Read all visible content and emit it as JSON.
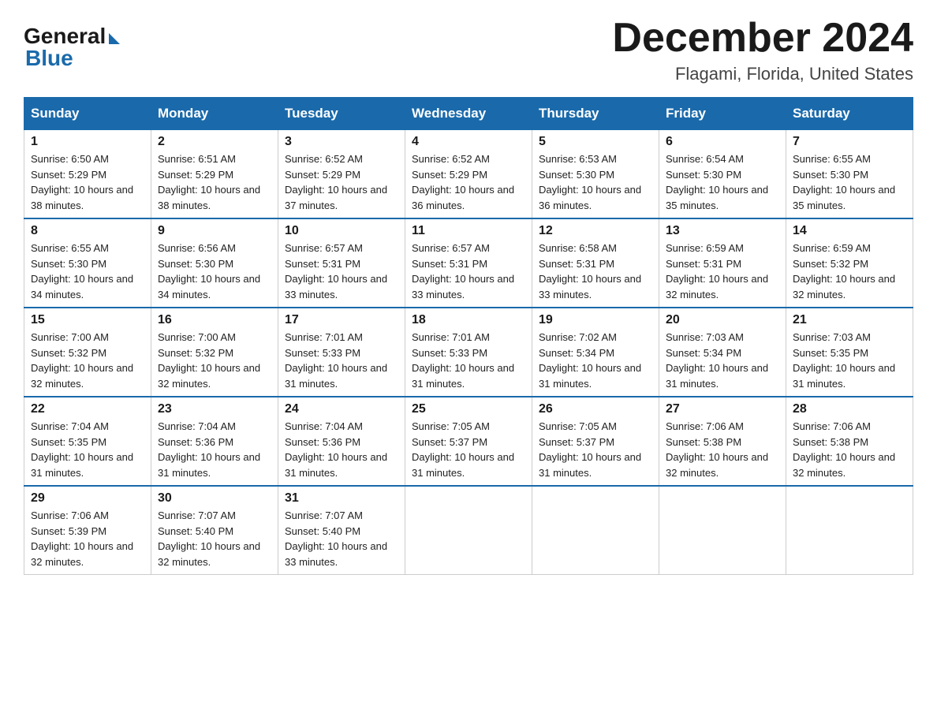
{
  "logo": {
    "general_text": "General",
    "blue_text": "Blue"
  },
  "header": {
    "month_year": "December 2024",
    "location": "Flagami, Florida, United States"
  },
  "days_of_week": [
    "Sunday",
    "Monday",
    "Tuesday",
    "Wednesday",
    "Thursday",
    "Friday",
    "Saturday"
  ],
  "weeks": [
    {
      "days": [
        {
          "num": "1",
          "sunrise": "6:50 AM",
          "sunset": "5:29 PM",
          "daylight": "10 hours and 38 minutes."
        },
        {
          "num": "2",
          "sunrise": "6:51 AM",
          "sunset": "5:29 PM",
          "daylight": "10 hours and 38 minutes."
        },
        {
          "num": "3",
          "sunrise": "6:52 AM",
          "sunset": "5:29 PM",
          "daylight": "10 hours and 37 minutes."
        },
        {
          "num": "4",
          "sunrise": "6:52 AM",
          "sunset": "5:29 PM",
          "daylight": "10 hours and 36 minutes."
        },
        {
          "num": "5",
          "sunrise": "6:53 AM",
          "sunset": "5:30 PM",
          "daylight": "10 hours and 36 minutes."
        },
        {
          "num": "6",
          "sunrise": "6:54 AM",
          "sunset": "5:30 PM",
          "daylight": "10 hours and 35 minutes."
        },
        {
          "num": "7",
          "sunrise": "6:55 AM",
          "sunset": "5:30 PM",
          "daylight": "10 hours and 35 minutes."
        }
      ]
    },
    {
      "days": [
        {
          "num": "8",
          "sunrise": "6:55 AM",
          "sunset": "5:30 PM",
          "daylight": "10 hours and 34 minutes."
        },
        {
          "num": "9",
          "sunrise": "6:56 AM",
          "sunset": "5:30 PM",
          "daylight": "10 hours and 34 minutes."
        },
        {
          "num": "10",
          "sunrise": "6:57 AM",
          "sunset": "5:31 PM",
          "daylight": "10 hours and 33 minutes."
        },
        {
          "num": "11",
          "sunrise": "6:57 AM",
          "sunset": "5:31 PM",
          "daylight": "10 hours and 33 minutes."
        },
        {
          "num": "12",
          "sunrise": "6:58 AM",
          "sunset": "5:31 PM",
          "daylight": "10 hours and 33 minutes."
        },
        {
          "num": "13",
          "sunrise": "6:59 AM",
          "sunset": "5:31 PM",
          "daylight": "10 hours and 32 minutes."
        },
        {
          "num": "14",
          "sunrise": "6:59 AM",
          "sunset": "5:32 PM",
          "daylight": "10 hours and 32 minutes."
        }
      ]
    },
    {
      "days": [
        {
          "num": "15",
          "sunrise": "7:00 AM",
          "sunset": "5:32 PM",
          "daylight": "10 hours and 32 minutes."
        },
        {
          "num": "16",
          "sunrise": "7:00 AM",
          "sunset": "5:32 PM",
          "daylight": "10 hours and 32 minutes."
        },
        {
          "num": "17",
          "sunrise": "7:01 AM",
          "sunset": "5:33 PM",
          "daylight": "10 hours and 31 minutes."
        },
        {
          "num": "18",
          "sunrise": "7:01 AM",
          "sunset": "5:33 PM",
          "daylight": "10 hours and 31 minutes."
        },
        {
          "num": "19",
          "sunrise": "7:02 AM",
          "sunset": "5:34 PM",
          "daylight": "10 hours and 31 minutes."
        },
        {
          "num": "20",
          "sunrise": "7:03 AM",
          "sunset": "5:34 PM",
          "daylight": "10 hours and 31 minutes."
        },
        {
          "num": "21",
          "sunrise": "7:03 AM",
          "sunset": "5:35 PM",
          "daylight": "10 hours and 31 minutes."
        }
      ]
    },
    {
      "days": [
        {
          "num": "22",
          "sunrise": "7:04 AM",
          "sunset": "5:35 PM",
          "daylight": "10 hours and 31 minutes."
        },
        {
          "num": "23",
          "sunrise": "7:04 AM",
          "sunset": "5:36 PM",
          "daylight": "10 hours and 31 minutes."
        },
        {
          "num": "24",
          "sunrise": "7:04 AM",
          "sunset": "5:36 PM",
          "daylight": "10 hours and 31 minutes."
        },
        {
          "num": "25",
          "sunrise": "7:05 AM",
          "sunset": "5:37 PM",
          "daylight": "10 hours and 31 minutes."
        },
        {
          "num": "26",
          "sunrise": "7:05 AM",
          "sunset": "5:37 PM",
          "daylight": "10 hours and 31 minutes."
        },
        {
          "num": "27",
          "sunrise": "7:06 AM",
          "sunset": "5:38 PM",
          "daylight": "10 hours and 32 minutes."
        },
        {
          "num": "28",
          "sunrise": "7:06 AM",
          "sunset": "5:38 PM",
          "daylight": "10 hours and 32 minutes."
        }
      ]
    },
    {
      "days": [
        {
          "num": "29",
          "sunrise": "7:06 AM",
          "sunset": "5:39 PM",
          "daylight": "10 hours and 32 minutes."
        },
        {
          "num": "30",
          "sunrise": "7:07 AM",
          "sunset": "5:40 PM",
          "daylight": "10 hours and 32 minutes."
        },
        {
          "num": "31",
          "sunrise": "7:07 AM",
          "sunset": "5:40 PM",
          "daylight": "10 hours and 33 minutes."
        },
        null,
        null,
        null,
        null
      ]
    }
  ],
  "labels": {
    "sunrise_prefix": "Sunrise: ",
    "sunset_prefix": "Sunset: ",
    "daylight_prefix": "Daylight: "
  }
}
